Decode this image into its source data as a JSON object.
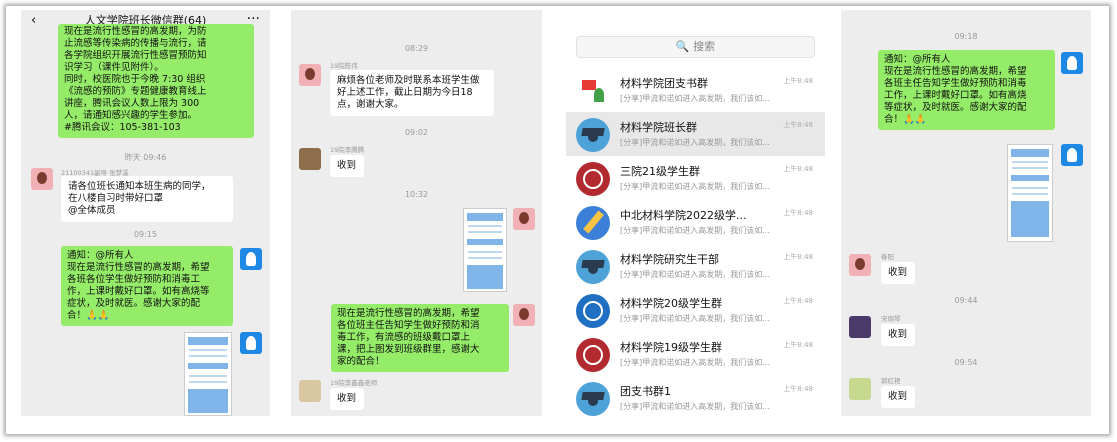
{
  "panel1": {
    "title": "人文学院班长微信群(64)",
    "back_glyph": "‹",
    "more_glyph": "···",
    "msg1_lines": [
      "现在是流行性感冒的高发期，为防",
      "止流感等传染病的传播与流行，请",
      "各学院组织开展流行性感冒预防知",
      "识学习（课件见附件）。",
      "同时，校医院也于今晚 7:30 组织",
      "《流感的预防》专题健康教育线上",
      "讲座，腾讯会议人数上限为 300",
      "人，请通知感兴趣的学生参加。"
    ],
    "msg1_link": "#腾讯会议：105-381-103",
    "time1": "昨天 09:46",
    "sender2": "21100341副导 张梦溪",
    "msg2_lines": [
      "请各位班长通知本班生病的同学，",
      "在八楼自习时带好口罩",
      "@全体成员"
    ],
    "time2": "09:15",
    "msg3_lines": [
      "通知：@所有人",
      "现在是流行性感冒的高发期，希望",
      "各班各位学生做好预防和消毒工",
      "作，上课时戴好口罩。如有高烧等",
      "症状，及时就医。感谢大家的配",
      "合！🙏🙏"
    ]
  },
  "panel2": {
    "time0": "08:29",
    "sender1": "19院陈伟",
    "msg1_lines": [
      "麻烦各位老师及时联系本班学生做",
      "好上述工作，截止日期为今日18",
      "点，谢谢大家。"
    ],
    "time1": "09:02",
    "sender2": "19院李腾腾",
    "msg2": "收到",
    "time2": "10:32",
    "msg3_lines": [
      "现在是流行性感冒的高发期，希望",
      "各位班主任告知学生做好预防和消",
      "毒工作，有流感的班级戴口罩上",
      "课，把上图发到班级群里，感谢大",
      "家的配合！"
    ],
    "sender4": "19院李鑫鑫老师",
    "msg4": "收到"
  },
  "panel3": {
    "search_icon": "search-icon",
    "search_placeholder": "🔍 搜索",
    "chats": [
      {
        "name": "材料学院团支书群",
        "time": "上午8:48",
        "preview": "[分享]甲流和诺如进入高发期，我们该如..."
      },
      {
        "name": "材料学院班长群",
        "time": "上午8:48",
        "preview": "[分享]甲流和诺如进入高发期，我们该如..."
      },
      {
        "name": "三院21级学生群",
        "time": "上午8:48",
        "preview": "[分享]甲流和诺如进入高发期，我们该如..."
      },
      {
        "name": "中北材料学院2022级学...",
        "time": "上午8:48",
        "preview": "[分享]甲流和诺如进入高发期，我们该如..."
      },
      {
        "name": "材料学院研究生干部",
        "time": "上午8:48",
        "preview": "[分享]甲流和诺如进入高发期，我们该如..."
      },
      {
        "name": "材料学院20级学生群",
        "time": "上午8:48",
        "preview": "[分享]甲流和诺如进入高发期，我们该如..."
      },
      {
        "name": "材料学院19级学生群",
        "time": "上午8:48",
        "preview": "[分享]甲流和诺如进入高发期，我们该如..."
      },
      {
        "name": "团支书群1",
        "time": "上午8:48",
        "preview": "[分享]甲流和诺如进入高发期，我们该如..."
      }
    ]
  },
  "panel4": {
    "time0": "09:18",
    "msg1_lines": [
      "通知：@所有人",
      "现在是流行性感冒的高发期，希望",
      "各班主任告知学生做好预防和消毒",
      "工作，上课时戴好口罩。如有高烧",
      "等症状，及时就医。感谢大家的配",
      "合！🙏🙏"
    ],
    "sender2": "春阳",
    "msg2": "收到",
    "time1": "09:44",
    "sender3": "宋琬琴",
    "msg3": "收到",
    "time2": "09:54",
    "sender4": "郭红艳",
    "msg4": "收到"
  }
}
